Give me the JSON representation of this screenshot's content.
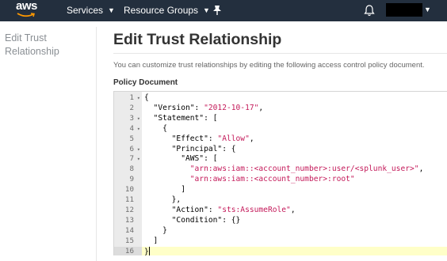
{
  "topnav": {
    "logo_text": "aws",
    "services_label": "Services",
    "resource_groups_label": "Resource Groups",
    "icons": [
      "chevron-down-icon",
      "pin-icon",
      "bell-icon"
    ]
  },
  "sidebar": {
    "title": "Edit Trust Relationship"
  },
  "main": {
    "title": "Edit Trust Relationship",
    "description": "You can customize trust relationships by editing the following access control policy document.",
    "policy_label": "Policy Document"
  },
  "colors": {
    "nav_bg": "#232f3e",
    "string": "#c41a5a",
    "active_line": "#ffffc8",
    "gutter": "#ebebeb"
  },
  "editor": {
    "active_line": 16,
    "lines": [
      {
        "num": "1",
        "fold": true,
        "segments": [
          {
            "t": "{",
            "s": false
          }
        ]
      },
      {
        "num": "2",
        "fold": false,
        "segments": [
          {
            "t": "  \"Version\": ",
            "s": false
          },
          {
            "t": "\"2012-10-17\"",
            "s": true
          },
          {
            "t": ",",
            "s": false
          }
        ]
      },
      {
        "num": "3",
        "fold": true,
        "segments": [
          {
            "t": "  \"Statement\": [",
            "s": false
          }
        ]
      },
      {
        "num": "4",
        "fold": true,
        "segments": [
          {
            "t": "    {",
            "s": false
          }
        ]
      },
      {
        "num": "5",
        "fold": false,
        "segments": [
          {
            "t": "      \"Effect\": ",
            "s": false
          },
          {
            "t": "\"Allow\"",
            "s": true
          },
          {
            "t": ",",
            "s": false
          }
        ]
      },
      {
        "num": "6",
        "fold": true,
        "segments": [
          {
            "t": "      \"Principal\": {",
            "s": false
          }
        ]
      },
      {
        "num": "7",
        "fold": true,
        "segments": [
          {
            "t": "        \"AWS\": [",
            "s": false
          }
        ]
      },
      {
        "num": "8",
        "fold": false,
        "segments": [
          {
            "t": "          ",
            "s": false
          },
          {
            "t": "\"arn:aws:iam::<account_number>:user/<splunk_user>\"",
            "s": true
          },
          {
            "t": ",",
            "s": false
          }
        ]
      },
      {
        "num": "9",
        "fold": false,
        "segments": [
          {
            "t": "          ",
            "s": false
          },
          {
            "t": "\"arn:aws:iam::<account_number>:root\"",
            "s": true
          }
        ]
      },
      {
        "num": "10",
        "fold": false,
        "segments": [
          {
            "t": "        ]",
            "s": false
          }
        ]
      },
      {
        "num": "11",
        "fold": false,
        "segments": [
          {
            "t": "      },",
            "s": false
          }
        ]
      },
      {
        "num": "12",
        "fold": false,
        "segments": [
          {
            "t": "      \"Action\": ",
            "s": false
          },
          {
            "t": "\"sts:AssumeRole\"",
            "s": true
          },
          {
            "t": ",",
            "s": false
          }
        ]
      },
      {
        "num": "13",
        "fold": false,
        "segments": [
          {
            "t": "      \"Condition\": {}",
            "s": false
          }
        ]
      },
      {
        "num": "14",
        "fold": false,
        "segments": [
          {
            "t": "    }",
            "s": false
          }
        ]
      },
      {
        "num": "15",
        "fold": false,
        "segments": [
          {
            "t": "  ]",
            "s": false
          }
        ]
      },
      {
        "num": "16",
        "fold": false,
        "segments": [
          {
            "t": "}",
            "s": false
          }
        ]
      }
    ]
  }
}
